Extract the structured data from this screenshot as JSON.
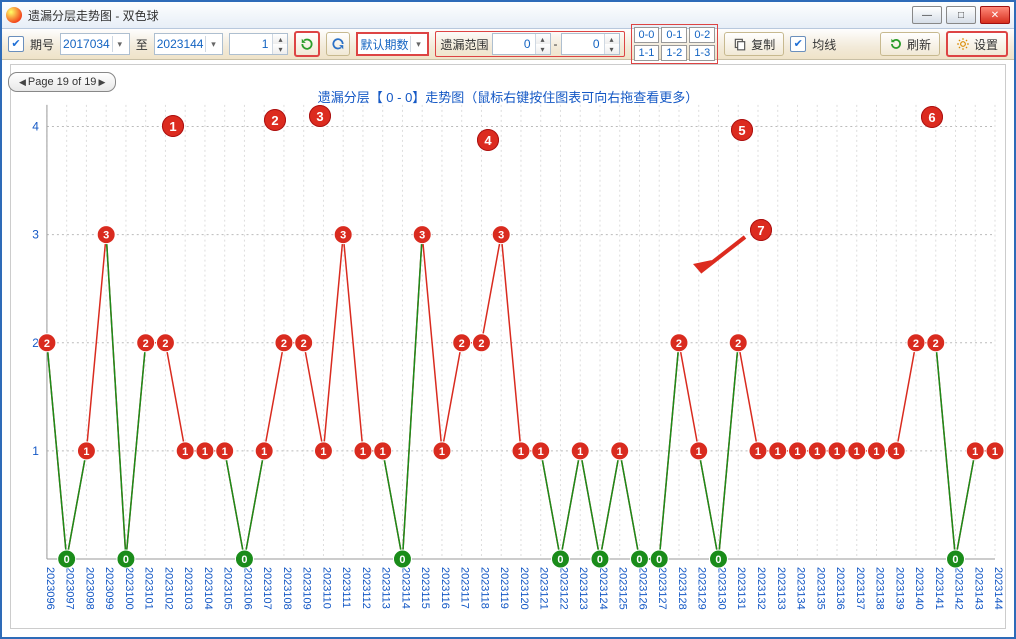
{
  "window_title": "遗漏分层走势图 - 双色球",
  "toolbar": {
    "period_label": "期号",
    "period_from": "2017034",
    "to_label": "至",
    "period_to": "2023144",
    "spinner1": "1",
    "mode_label": "默认期数",
    "range_label": "遗漏范围",
    "range_from": "0",
    "range_dash": "-",
    "range_to": "0",
    "matrix": [
      [
        "0-0",
        "0-1",
        "0-2"
      ],
      [
        "1-1",
        "1-2",
        "1-3"
      ]
    ],
    "copy_label": "复制",
    "avg_label": "均线",
    "refresh_label": "刷新",
    "settings_label": "设置"
  },
  "pager": "Page 19 of 19",
  "chart_title": "遗漏分层【 0 - 0】走势图（鼠标右键按住图表可向右拖查看更多）",
  "callouts": [
    "1",
    "2",
    "3",
    "4",
    "5",
    "6",
    "7"
  ],
  "chart_data": {
    "type": "line",
    "title": "遗漏分层【 0 - 0】走势图",
    "ylabel": "",
    "xlabel": "",
    "ylim": [
      0,
      4.2
    ],
    "yticks": [
      1,
      2,
      3,
      4
    ],
    "categories": [
      "2023096",
      "2023097",
      "2023098",
      "2023099",
      "2023100",
      "2023101",
      "2023102",
      "2023103",
      "2023104",
      "2023105",
      "2023106",
      "2023107",
      "2023108",
      "2023109",
      "2023110",
      "2023111",
      "2023112",
      "2023113",
      "2023114",
      "2023115",
      "2023116",
      "2023117",
      "2023118",
      "2023119",
      "2023120",
      "2023121",
      "2023122",
      "2023123",
      "2023124",
      "2023125",
      "2023126",
      "2023127",
      "2023128",
      "2023129",
      "2023130",
      "2023131",
      "2023132",
      "2023133",
      "2023134",
      "2023135",
      "2023136",
      "2023137",
      "2023138",
      "2023139",
      "2023140",
      "2023141",
      "2023142",
      "2023143",
      "2023144"
    ],
    "series": [
      {
        "name": "main",
        "values": [
          2,
          0,
          1,
          3,
          0,
          2,
          2,
          1,
          1,
          1,
          0,
          1,
          2,
          2,
          1,
          3,
          1,
          1,
          0,
          3,
          1,
          2,
          2,
          3,
          1,
          1,
          0,
          1,
          0,
          1,
          0,
          0,
          2,
          1,
          0,
          2,
          1,
          1,
          1,
          1,
          1,
          1,
          1,
          1,
          2,
          2,
          0,
          1,
          1
        ],
        "color": "#d92b1f"
      },
      {
        "name": "green",
        "values": [
          null,
          0,
          null,
          null,
          0,
          null,
          null,
          null,
          null,
          null,
          0,
          null,
          null,
          null,
          null,
          null,
          null,
          null,
          0,
          null,
          null,
          null,
          null,
          null,
          null,
          null,
          0,
          null,
          0,
          null,
          0,
          0,
          null,
          null,
          0,
          null,
          null,
          null,
          null,
          null,
          null,
          null,
          null,
          null,
          null,
          null,
          0,
          null,
          null
        ],
        "color": "#1a8c1a"
      }
    ]
  }
}
